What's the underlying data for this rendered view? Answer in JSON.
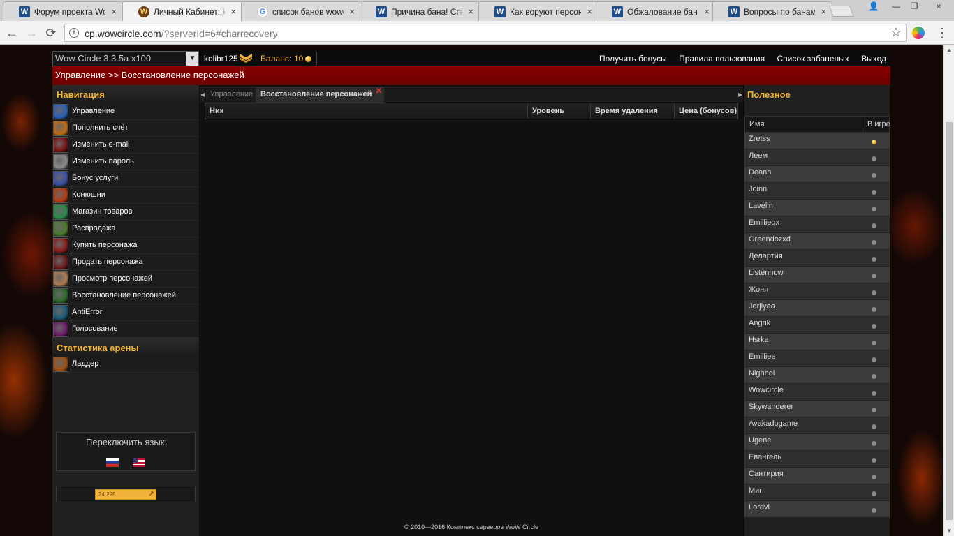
{
  "browser": {
    "tabs": [
      {
        "title": "Форум проекта WoW",
        "fav": "W"
      },
      {
        "title": "Личный Кабинет: log",
        "fav": "W"
      },
      {
        "title": "список банов wowcir",
        "fav": "G"
      },
      {
        "title": "Причина бана! Спис",
        "fav": "W"
      },
      {
        "title": "Как воруют персона",
        "fav": "W"
      },
      {
        "title": "Обжалование банов",
        "fav": "W"
      },
      {
        "title": "Вопросы по банам. С",
        "fav": "W"
      }
    ],
    "url_host": "cp.wowcircle.com",
    "url_path": "/?serverId=6#charrecovery",
    "icons": {
      "back": "←",
      "forward": "→",
      "reload": "⟳",
      "info": "i",
      "star": "☆",
      "menu": "⋮",
      "close": "×",
      "min": "—",
      "max": "❐",
      "user": "👤"
    }
  },
  "topbar": {
    "server": "Wow Circle 3.3.5a x100",
    "select_arrow": "▼",
    "username": "kolibr125",
    "balance_label": "Баланс:",
    "balance_value": "10",
    "links": [
      "Получить бонусы",
      "Правила пользования",
      "Список забаненых",
      "Выход"
    ]
  },
  "breadcrumb": "Управление >> Восстановление персонажей",
  "nav": {
    "heading": "Навигация",
    "items": [
      {
        "label": "Управление",
        "color": "#2a5fb8"
      },
      {
        "label": "Пополнить счёт",
        "color": "#c46a12"
      },
      {
        "label": "Изменить e-mail",
        "color": "#7a1010"
      },
      {
        "label": "Изменить пароль",
        "color": "#8a8a8a"
      },
      {
        "label": "Бонус услуги",
        "color": "#3a4fa8"
      },
      {
        "label": "Конюшни",
        "color": "#b83a10"
      },
      {
        "label": "Магазин товаров",
        "color": "#2a8a4a"
      },
      {
        "label": "Распродажа",
        "color": "#4a7a2a"
      },
      {
        "label": "Купить персонажа",
        "color": "#8a1a1a"
      },
      {
        "label": "Продать персонажа",
        "color": "#6a1a1a"
      },
      {
        "label": "Просмотр персонажей",
        "color": "#b07a50"
      },
      {
        "label": "Восстановление персонажей",
        "color": "#2a6a2a"
      },
      {
        "label": "AntiError",
        "color": "#1a5a7a"
      },
      {
        "label": "Голосование",
        "color": "#6a1a6a"
      }
    ],
    "arena_heading": "Статистика арены",
    "arena_items": [
      {
        "label": "Ладдер",
        "color": "#a05010"
      }
    ],
    "lang_title": "Переключить язык:",
    "counter": "24 299",
    "counter_arrow": "↗"
  },
  "main": {
    "tabs": {
      "inactive": "Управление",
      "active": "Восстановление персонажей",
      "close": "✕"
    },
    "edges": {
      "left": "◀",
      "right": "▶"
    },
    "columns": [
      "Ник",
      "Уровень",
      "Время удаления",
      "Цена (бонусов)"
    ]
  },
  "useful": {
    "heading": "Полезное",
    "col_name": "Имя",
    "col_status": "В игре",
    "players": [
      {
        "name": "Zretss",
        "online": true
      },
      {
        "name": "Леем",
        "online": false
      },
      {
        "name": "Deanh",
        "online": false
      },
      {
        "name": "Joinn",
        "online": false
      },
      {
        "name": "Lavelin",
        "online": false
      },
      {
        "name": "Emillieqx",
        "online": false
      },
      {
        "name": "Greendozxd",
        "online": false
      },
      {
        "name": "Делартия",
        "online": false
      },
      {
        "name": "Listennow",
        "online": false
      },
      {
        "name": "Жоня",
        "online": false
      },
      {
        "name": "Jorjiyaa",
        "online": false
      },
      {
        "name": "Angrik",
        "online": false
      },
      {
        "name": "Hsrka",
        "online": false
      },
      {
        "name": "Emilliee",
        "online": false
      },
      {
        "name": "Nighhol",
        "online": false
      },
      {
        "name": "Wowcircle",
        "online": false
      },
      {
        "name": "Skywanderer",
        "online": false
      },
      {
        "name": "Avakadogame",
        "online": false
      },
      {
        "name": "Ugene",
        "online": false
      },
      {
        "name": "Евангель",
        "online": false
      },
      {
        "name": "Сантирия",
        "online": false
      },
      {
        "name": "Миг",
        "online": false
      },
      {
        "name": "Lordvi",
        "online": false
      }
    ]
  },
  "footer": "© 2010—2016 Комплекс серверов WoW Circle"
}
